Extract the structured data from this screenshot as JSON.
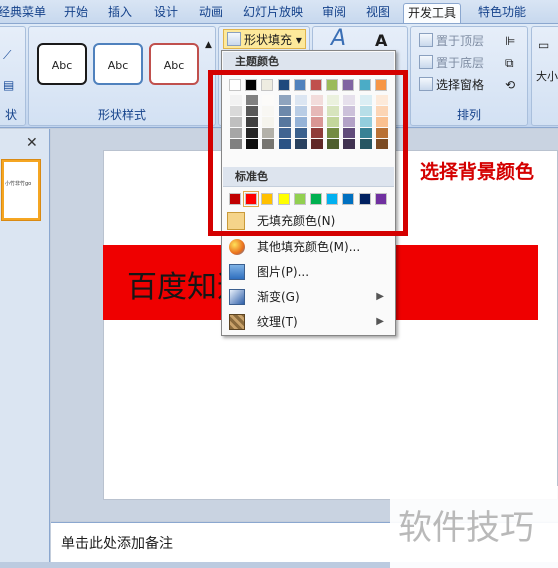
{
  "tabs": {
    "classic": "经典菜单",
    "start": "开始",
    "insert": "插入",
    "design": "设计",
    "animation": "动画",
    "slideshow": "幻灯片放映",
    "review": "审阅",
    "view": "视图",
    "developer": "开发工具",
    "special": "特色功能"
  },
  "ribbon": {
    "abc1": "Abc",
    "abc2": "Abc",
    "abc3": "Abc",
    "shape_style_label": "形状样式",
    "left_group_label": "状",
    "shape_fill": "形状填充",
    "bring_top": "置于顶层",
    "send_bottom": "置于底层",
    "selection_pane": "选择窗格",
    "arrange_label": "排列",
    "size_label": "大小"
  },
  "leftpanel": {
    "close": "✕",
    "thumb_text": "小竹非竹go"
  },
  "slide": {
    "text": "百度知道-竹非竹go"
  },
  "notes": {
    "placeholder": "单击此处添加备注"
  },
  "menu": {
    "theme_colors_header": "主题颜色",
    "standard_colors_header": "标准色",
    "no_fill": "无填充颜色(N)",
    "more_colors": "其他填充颜色(M)...",
    "picture": "图片(P)...",
    "gradient": "渐变(G)",
    "texture": "纹理(T)"
  },
  "annotation": {
    "label": "选择背景颜色"
  },
  "watermark": {
    "text": "软件技巧"
  },
  "colors": {
    "theme_top": [
      "#ffffff",
      "#000000",
      "#eeece1",
      "#1f497d",
      "#4f81bd",
      "#c0504d",
      "#9bbb59",
      "#8064a2",
      "#4bacc6",
      "#f79646"
    ],
    "standard": [
      "#c00000",
      "#ff0000",
      "#ffc000",
      "#ffff00",
      "#92d050",
      "#00b050",
      "#00b0f0",
      "#0070c0",
      "#002060",
      "#7030a0"
    ],
    "annotation": "#d40000",
    "slide_bar": "#ef0000"
  }
}
